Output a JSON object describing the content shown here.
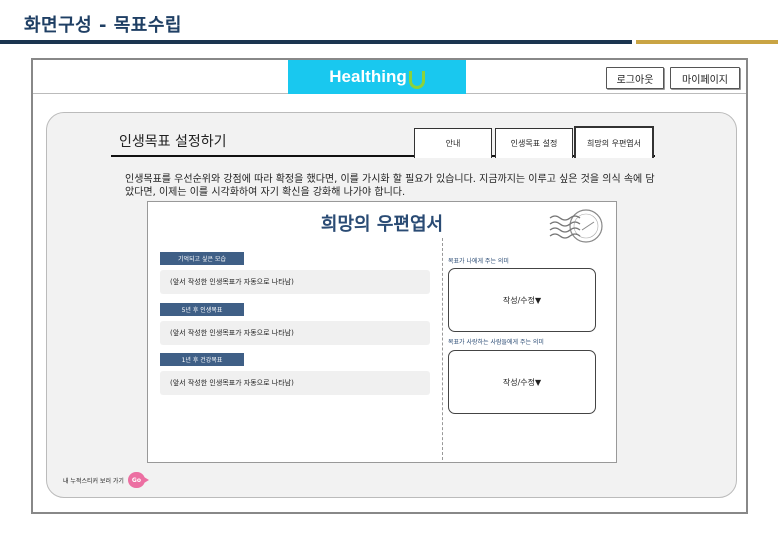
{
  "slide_title": "화면구성 - 목표수립",
  "header": {
    "logo": "Healthing",
    "logout": "로그아웃",
    "mypage": "마이페이지"
  },
  "panel": {
    "title": "인생목표 설정하기",
    "tabs": [
      {
        "label": "안내"
      },
      {
        "label": "인생목표 설정"
      },
      {
        "label": "희망의 우편엽서",
        "active": true
      }
    ],
    "description": "인생목표를 우선순위와 강점에 따라 확정을 했다면, 이를 가시화 할 필요가 있습니다. 지금까지는 이루고 싶은 것을 의식 속에 담았다면, 이제는 이를 시각화하여 자기 확신을 강화해 나가야 합니다."
  },
  "card": {
    "title": "희망의 우편엽서",
    "left_items": [
      {
        "label": "기억되고 싶은 모습",
        "value": "(앞서 작성한 인생목표가 자동으로 나타남)"
      },
      {
        "label": "5년 후 인생목표",
        "value": "(앞서 작성한 인생목표가 자동으로 나타남)"
      },
      {
        "label": "1년 후 건강목표",
        "value": "(앞서 작성한 인생목표가 자동으로 나타남)"
      }
    ],
    "right_items": [
      {
        "label": "목표가 나에게 주는 의미",
        "button": "작성/수정▼"
      },
      {
        "label": "목표가 사랑하는 사람들에게 주는 의미",
        "button": "작성/수정▼"
      }
    ]
  },
  "footer": {
    "link_text": "내 누적스티커 보러 가기",
    "go": "Go"
  },
  "colors": {
    "navy": "#1b3550",
    "gold": "#c9a444",
    "logo_bg": "#19c8ef",
    "label_bg": "#3f5f86",
    "go_pink": "#ec6fa2"
  }
}
